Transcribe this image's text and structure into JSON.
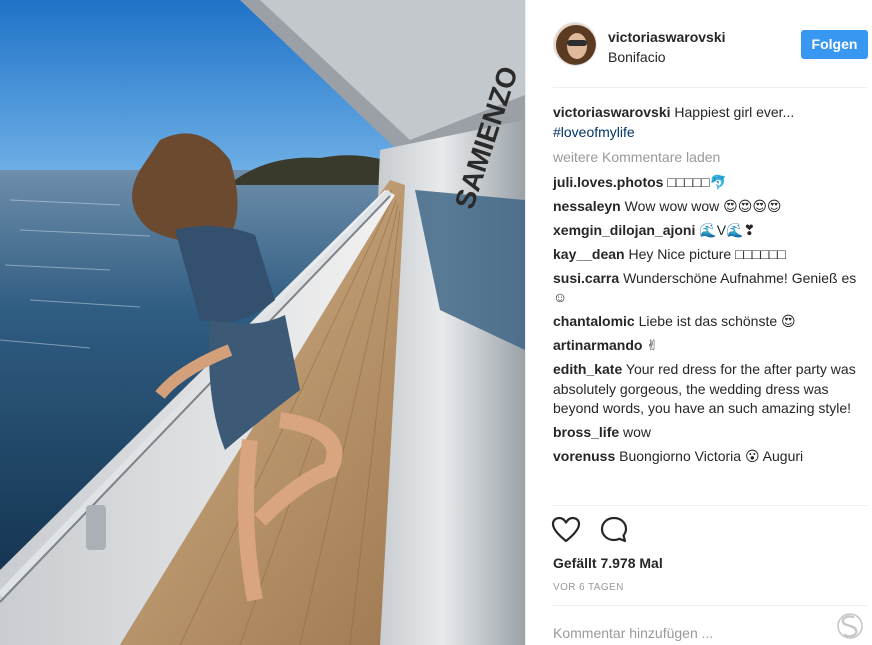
{
  "post": {
    "username": "victoriaswarovski",
    "location": "Bonifacio",
    "follow_label": "Folgen",
    "caption_user": "victoriaswarovski",
    "caption_text": "Happiest girl ever...",
    "caption_hashtag": "#loveofmylife",
    "load_more": "weitere Kommentare laden",
    "comments": [
      {
        "user": "juli.loves.photos",
        "text": "□□□□□🐬"
      },
      {
        "user": "nessaleyn",
        "text": "Wow wow wow 😍😍😍😍"
      },
      {
        "user": "xemgin_dilojan_ajoni",
        "text": "🌊V🌊❣"
      },
      {
        "user": "kay__dean",
        "text": "Hey Nice picture □□□□□□"
      },
      {
        "user": "susi.carra",
        "text": "Wunderschöne Aufnahme! Genieß es ☺"
      },
      {
        "user": "chantalomic",
        "text": "Liebe ist das schönste 😍"
      },
      {
        "user": "artinarmando",
        "text": "✌"
      },
      {
        "user": "edith_kate",
        "text": "Your red dress for the after party was absolutely gorgeous, the wedding dress was beyond words, you have an such amazing style!"
      },
      {
        "user": "bross_life",
        "text": "wow"
      },
      {
        "user": "vorenuss",
        "text": "Buongiorno Victoria 😮 Auguri"
      }
    ],
    "likes": "Gefällt 7.978 Mal",
    "time": "VOR 6 TAGEN",
    "add_comment_placeholder": "Kommentar hinzufügen ..."
  },
  "icons": {
    "like": "heart-icon",
    "comment": "comment-bubble-icon",
    "more": "more-options-icon"
  },
  "colors": {
    "follow_button": "#3897f0",
    "hashtag": "#003569",
    "muted": "#999999"
  }
}
